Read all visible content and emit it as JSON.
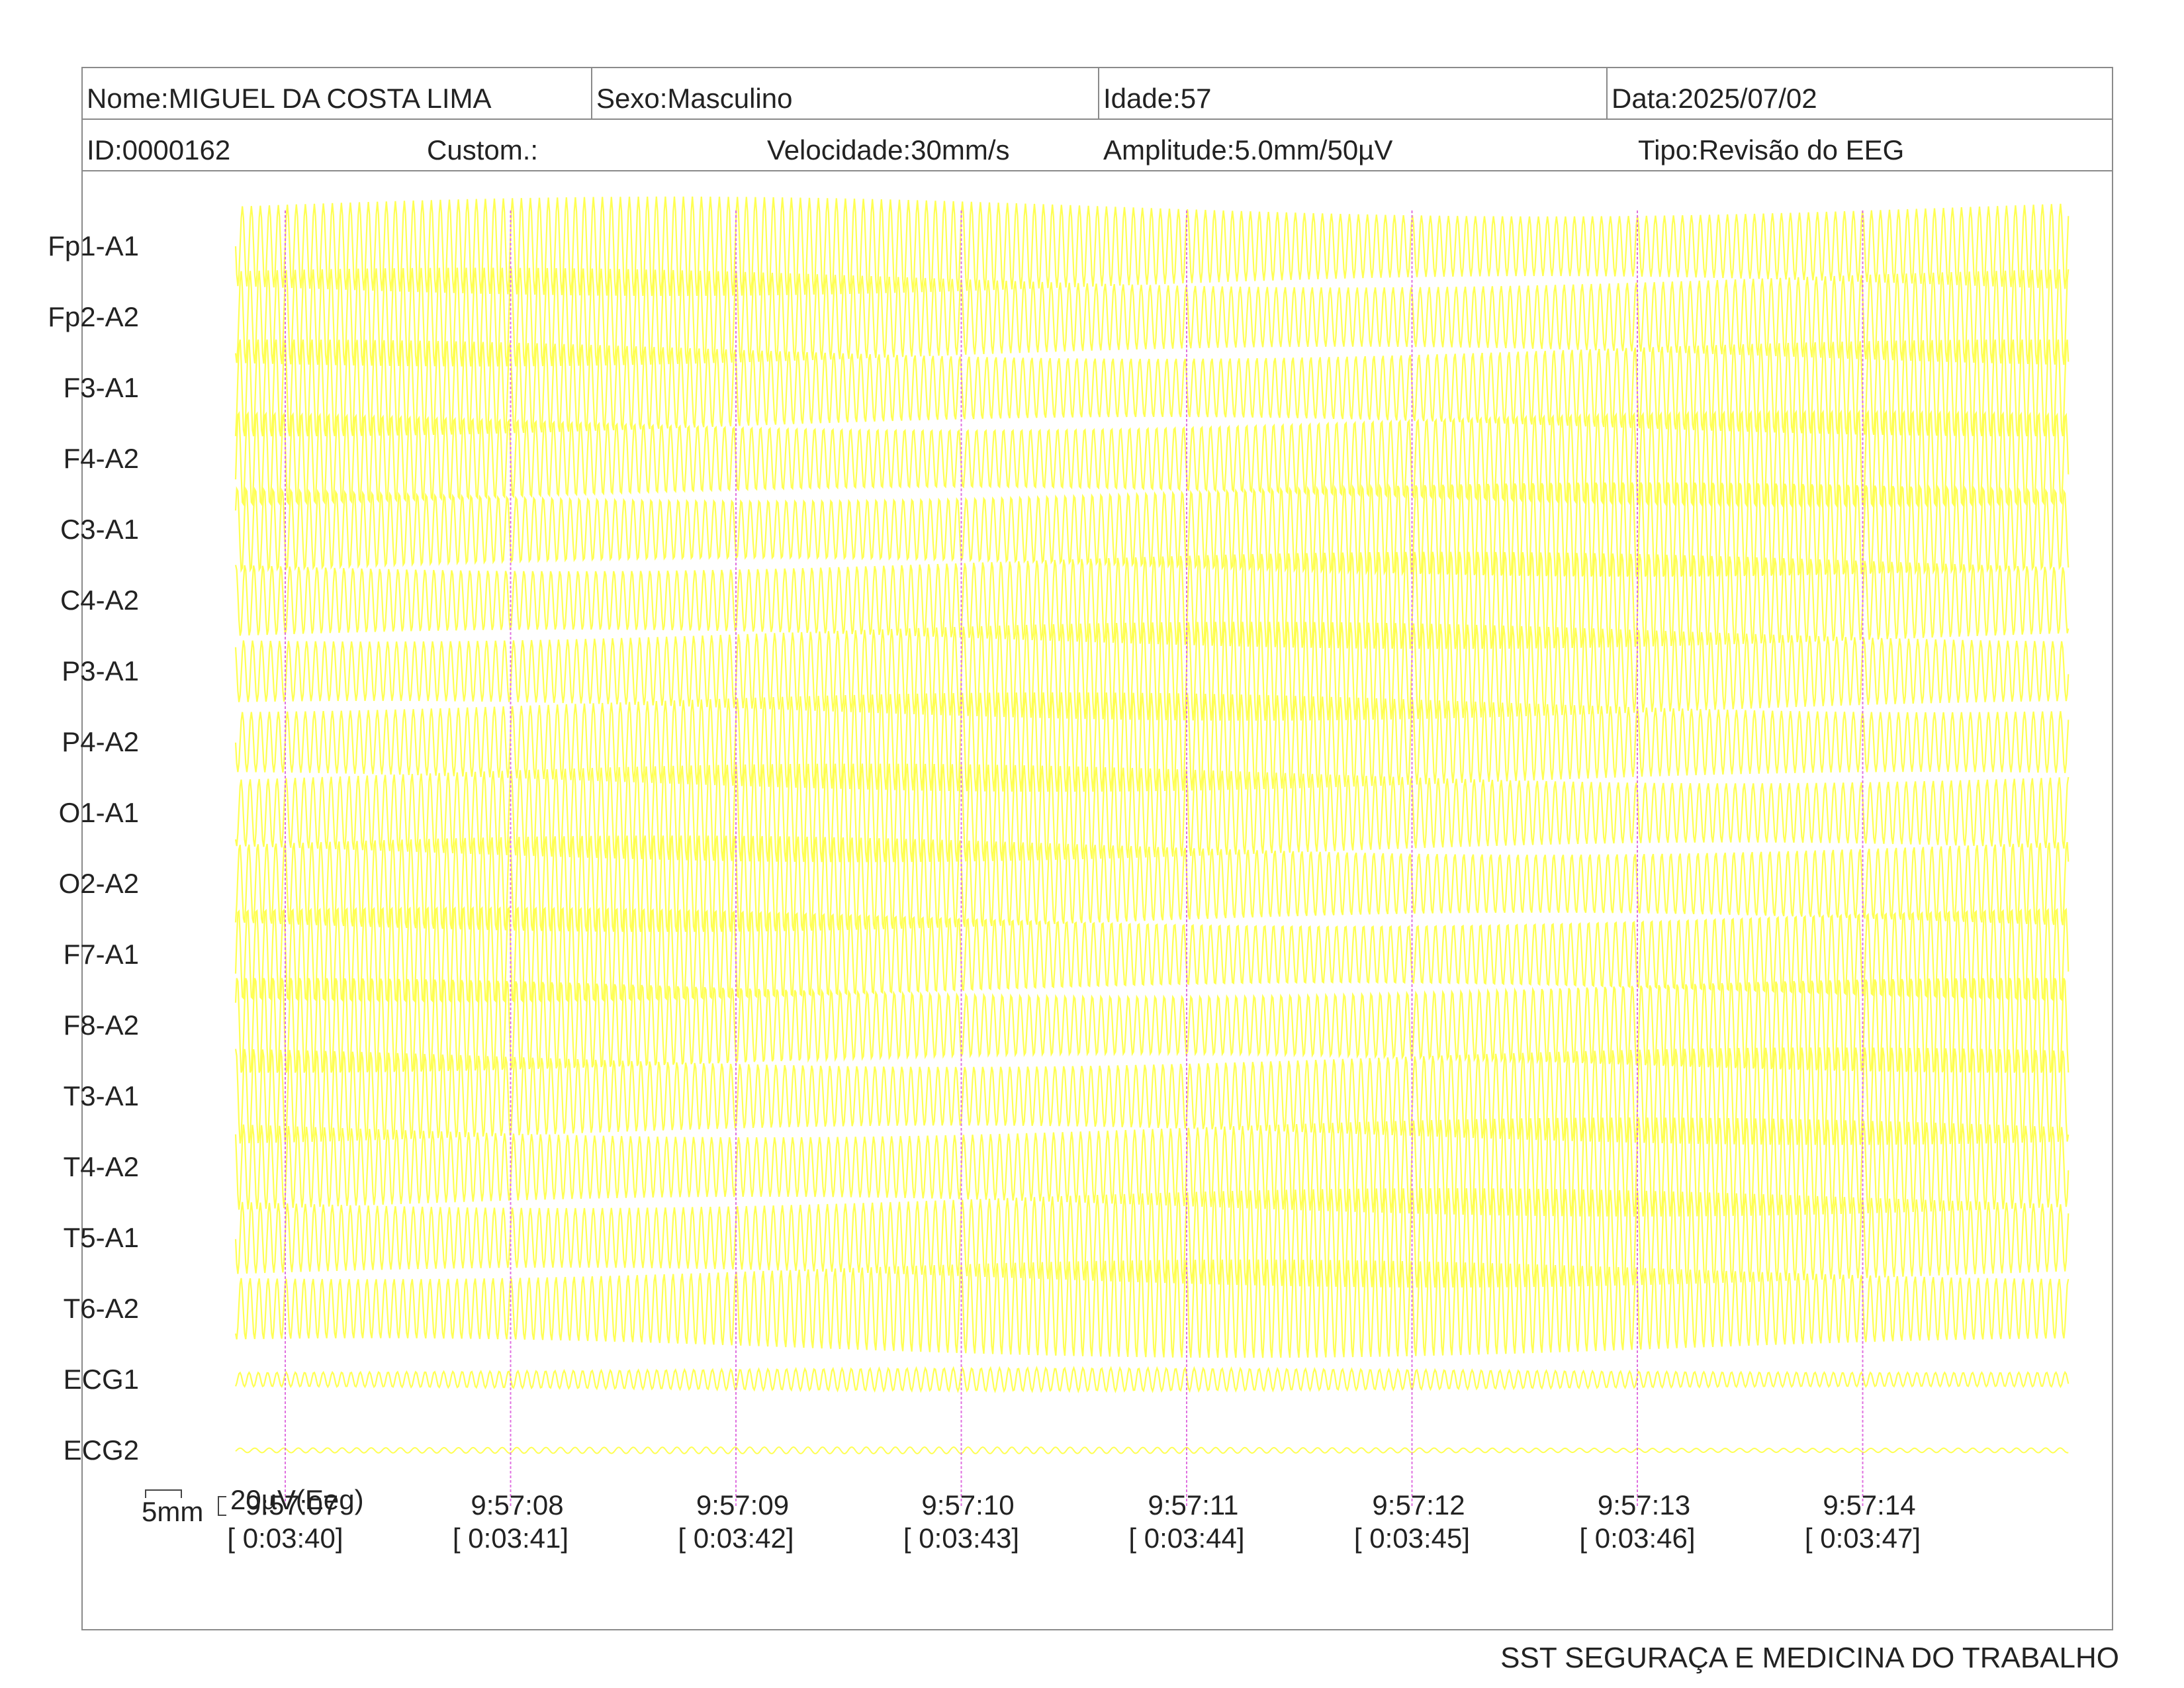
{
  "header": {
    "nome": "Nome:MIGUEL DA COSTA LIMA",
    "sexo": "Sexo:Masculino",
    "idade": "Idade:57",
    "data": "Data:2025/07/02",
    "id": "ID:0000162",
    "custom": "Custom.:",
    "velocidade": "Velocidade:30mm/s",
    "amplitude": "Amplitude:5.0mm/50µV",
    "tipo": "Tipo:Revisão do EEG"
  },
  "leads": [
    "Fp1-A1",
    "Fp2-A2",
    "F3-A1",
    "F4-A2",
    "C3-A1",
    "C4-A2",
    "P3-A1",
    "P4-A2",
    "O1-A1",
    "O2-A2",
    "F7-A1",
    "F8-A2",
    "T3-A1",
    "T4-A2",
    "T5-A1",
    "T6-A2",
    "ECG1",
    "ECG2"
  ],
  "time_marks": [
    {
      "clock": "9:57:07",
      "elapsed": "[ 0:03:40]"
    },
    {
      "clock": "9:57:08",
      "elapsed": "[ 0:03:41]"
    },
    {
      "clock": "9:57:09",
      "elapsed": "[ 0:03:42]"
    },
    {
      "clock": "9:57:10",
      "elapsed": "[ 0:03:43]"
    },
    {
      "clock": "9:57:11",
      "elapsed": "[ 0:03:44]"
    },
    {
      "clock": "9:57:12",
      "elapsed": "[ 0:03:45]"
    },
    {
      "clock": "9:57:13",
      "elapsed": "[ 0:03:46]"
    },
    {
      "clock": "9:57:14",
      "elapsed": "[ 0:03:47]"
    }
  ],
  "scale": {
    "time": "5mm",
    "amplitude": "20µV(Eeg)"
  },
  "footer": "SST SEGURAÇA E MEDICINA DO TRABALHO",
  "colors": {
    "trace": "#ffff40",
    "marker": "#e070e0",
    "border": "#8a8a8a",
    "text": "#222222"
  }
}
